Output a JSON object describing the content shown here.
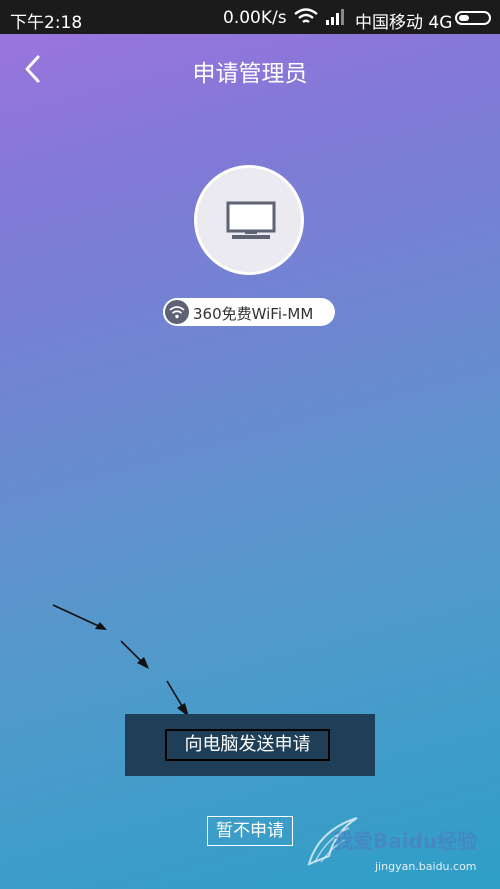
{
  "status_bar": {
    "time": "下午2:18",
    "net_speed": "0.00K/s",
    "carrier": "中国移动 4G"
  },
  "header": {
    "title": "申请管理员",
    "back_icon": "chevron-left-icon"
  },
  "device": {
    "icon": "monitor-icon",
    "network_icon": "wifi-icon",
    "network_name": "360免费WiFi-MM"
  },
  "actions": {
    "send_request_label": "向电脑发送申请",
    "not_now_label": "暂不申请"
  },
  "watermark": {
    "text": "我爱Baidu经验",
    "url": "jingyan.baidu.com"
  },
  "colors": {
    "gradient_top": "#9f73df",
    "gradient_bottom": "#2e9fc7",
    "panel_bg": "#1e3f57",
    "device_circle": "#ebeaf0"
  }
}
